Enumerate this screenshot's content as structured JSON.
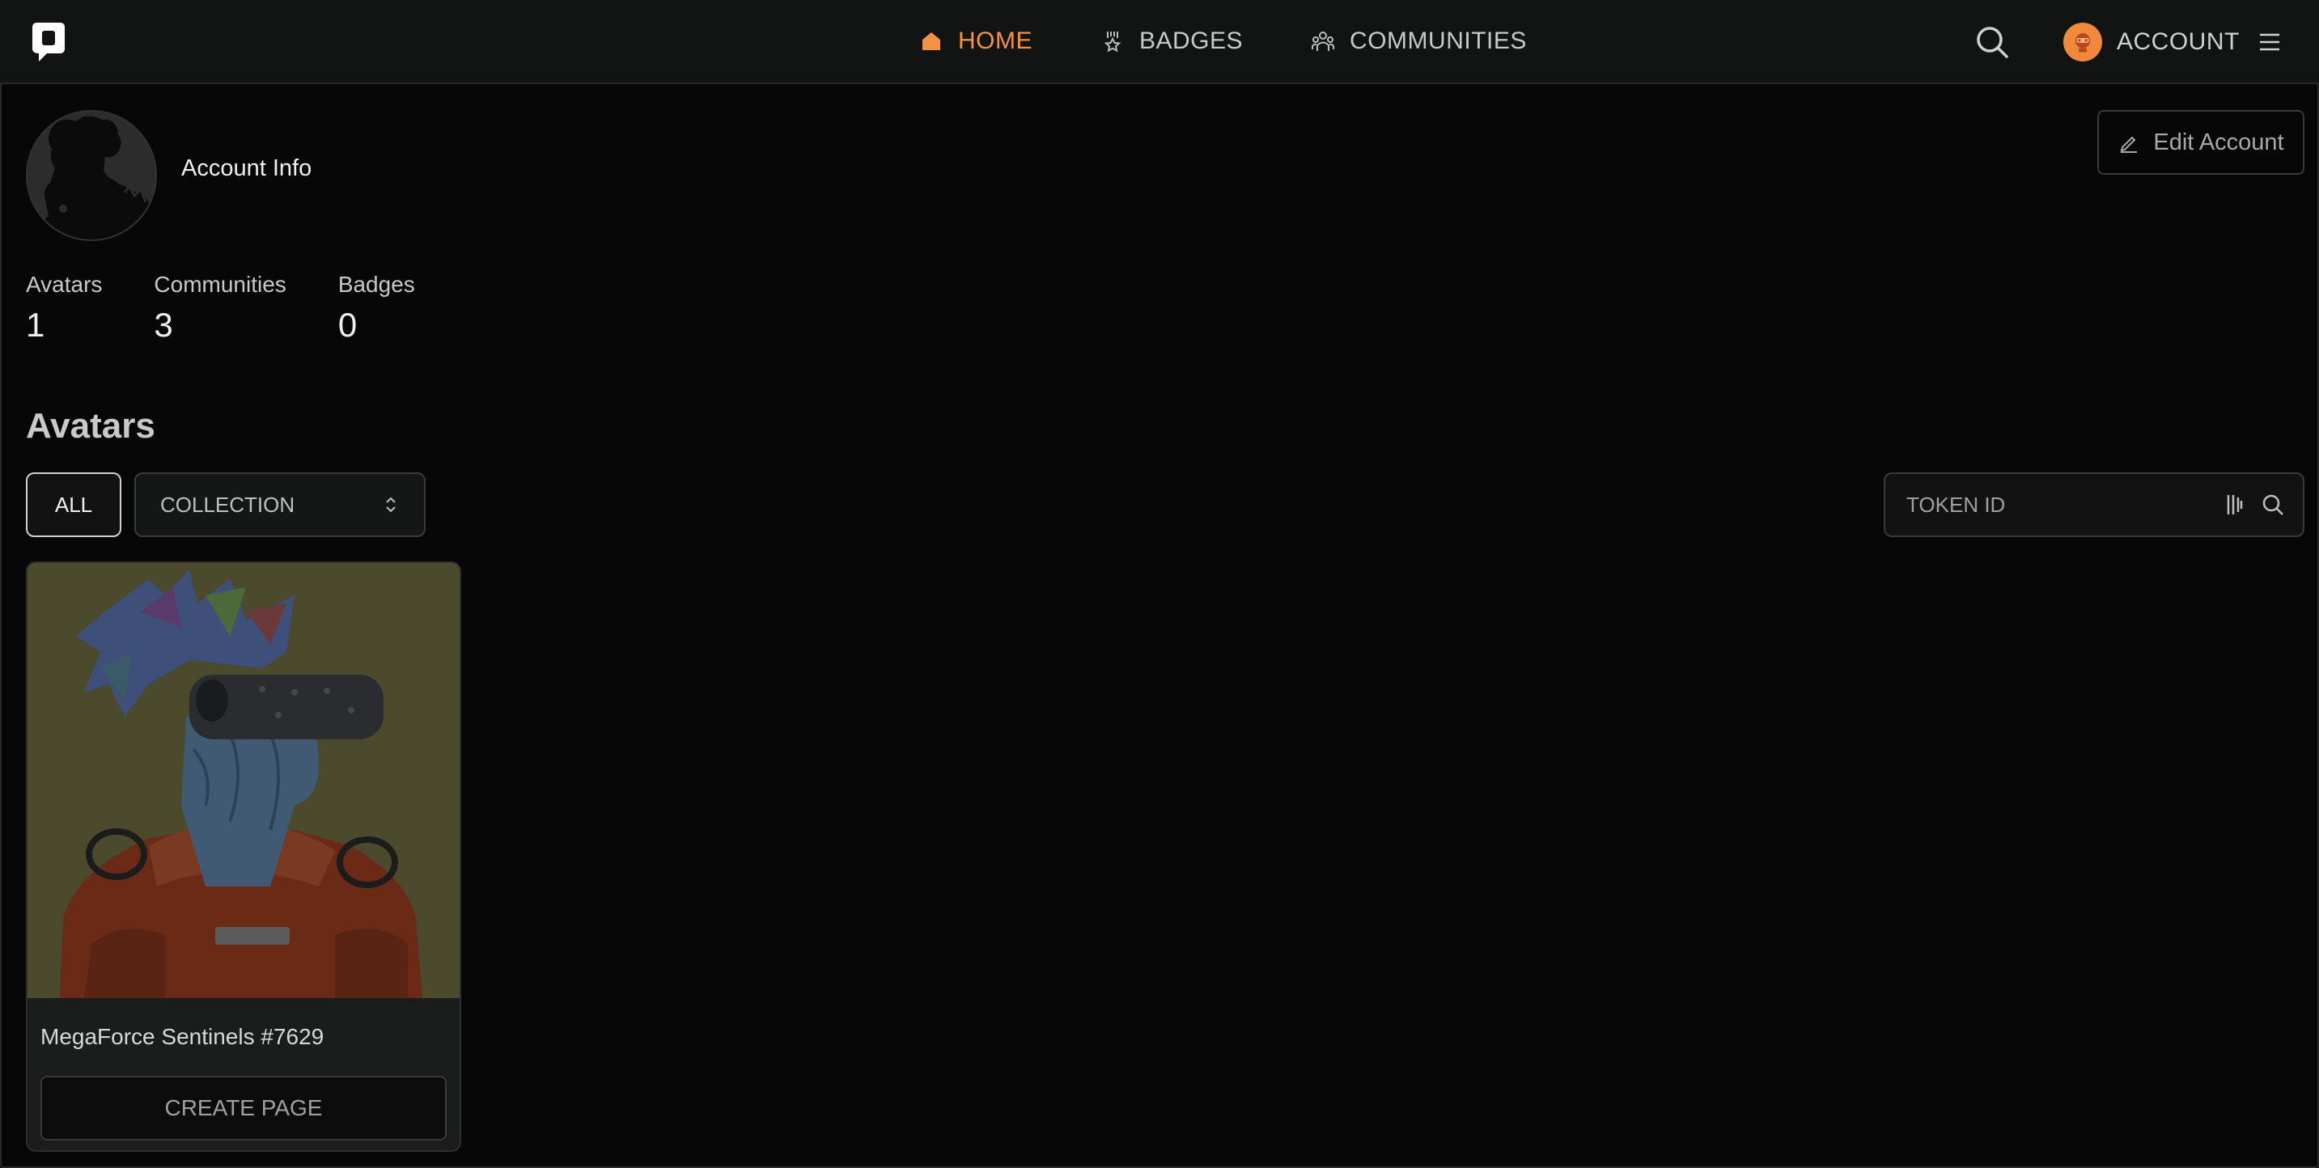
{
  "nav": {
    "items": [
      {
        "label": "HOME",
        "icon": "home-icon",
        "active": true
      },
      {
        "label": "BADGES",
        "icon": "badge-icon",
        "active": false
      },
      {
        "label": "COMMUNITIES",
        "icon": "communities-icon",
        "active": false
      }
    ],
    "account_label": "ACCOUNT",
    "accent_color": "#f29245"
  },
  "profile": {
    "account_info_label": "Account Info",
    "edit_account_label": "Edit Account",
    "stats": [
      {
        "label": "Avatars",
        "value": "1"
      },
      {
        "label": "Communities",
        "value": "3"
      },
      {
        "label": "Badges",
        "value": "0"
      }
    ]
  },
  "avatars": {
    "section_title": "Avatars",
    "filter_all_label": "ALL",
    "collection_select": "COLLECTION",
    "token_placeholder": "TOKEN ID",
    "cards": [
      {
        "title": "MegaForce Sentinels #7629",
        "button": "CREATE PAGE"
      }
    ]
  }
}
